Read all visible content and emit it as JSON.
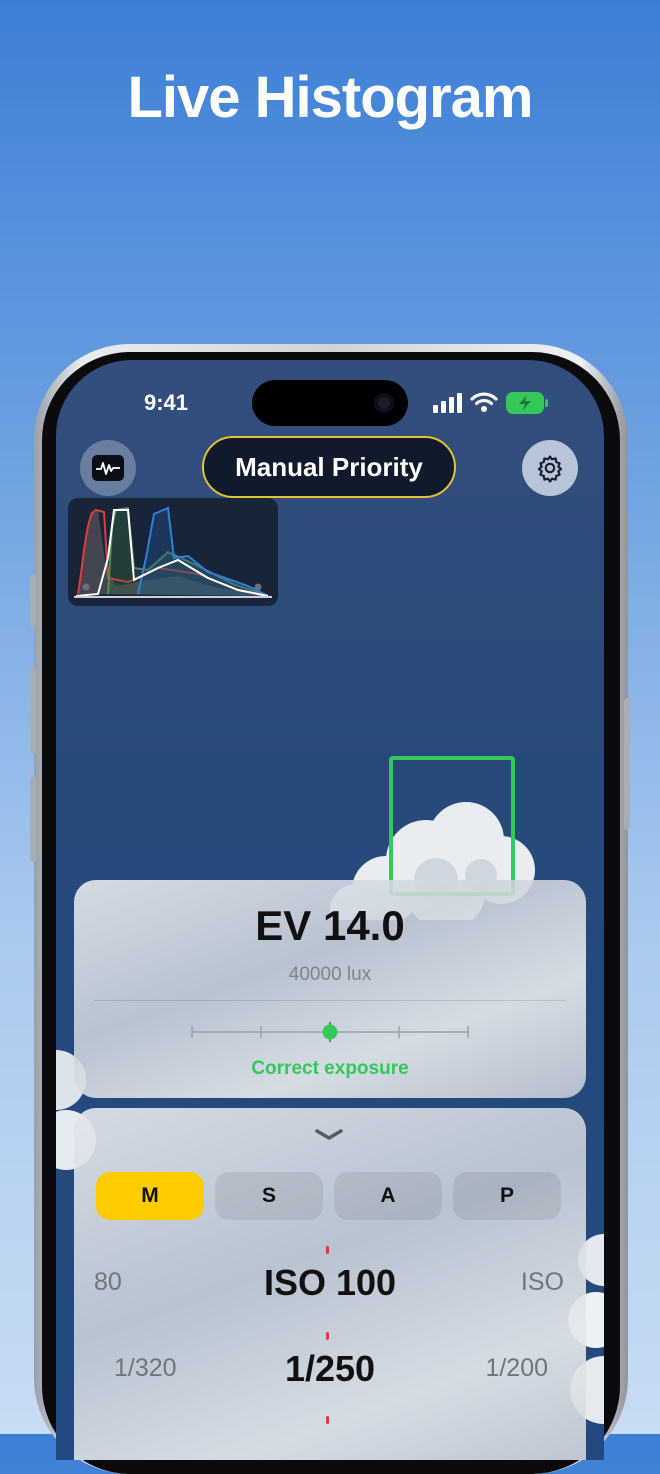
{
  "headline": "Live Histogram",
  "status_bar": {
    "time": "9:41"
  },
  "top_bar": {
    "histogram_icon": "waveform-icon",
    "mode_title": "Manual Priority",
    "settings_icon": "gear-icon"
  },
  "exposure": {
    "ev": "EV 14.0",
    "lux": "40000 lux",
    "status": "Correct exposure",
    "meter_position": 0.5
  },
  "modes": [
    {
      "label": "M",
      "active": true
    },
    {
      "label": "S",
      "active": false
    },
    {
      "label": "A",
      "active": false
    },
    {
      "label": "P",
      "active": false
    }
  ],
  "wheels": {
    "iso": {
      "left": "80",
      "center": "ISO 100",
      "right": "ISO"
    },
    "shutter": {
      "left": "1/320",
      "center": "1/250",
      "right": "1/200"
    }
  },
  "colors": {
    "accent": "#ffcc00",
    "ok": "#34c759",
    "focus": "#35c95a",
    "pill_border": "#e5c232"
  }
}
